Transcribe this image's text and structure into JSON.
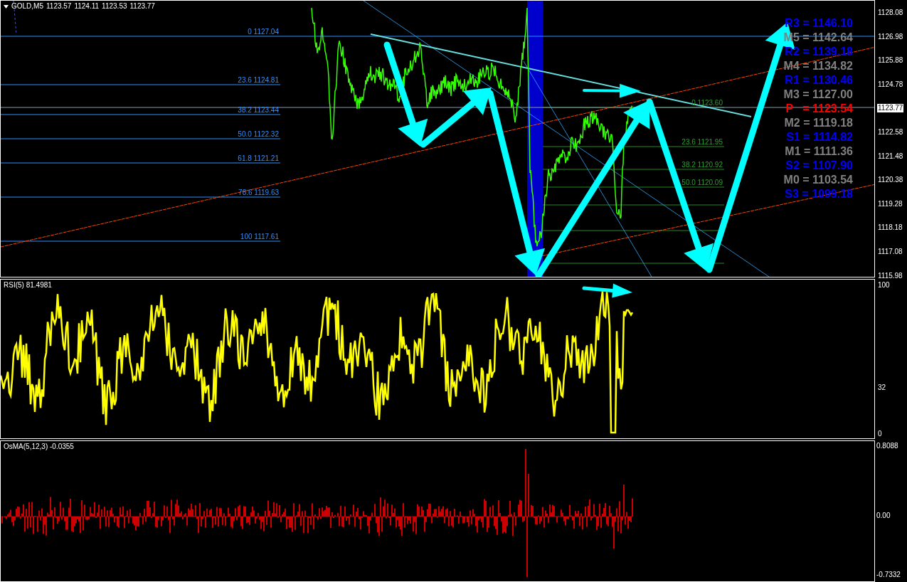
{
  "header": {
    "symbol": "GOLD,M5",
    "ohlc": [
      "1123.57",
      "1124.11",
      "1123.53",
      "1123.77"
    ]
  },
  "fib_left": [
    "0 1127.04",
    "23.6 1124.81",
    "38.2 1123.44",
    "50.0 1122.32",
    "61.8 1121.21",
    "78.6 1119.63",
    "100 1117.61"
  ],
  "fib_right": [
    "0 1123.60",
    "23.6 1121.95",
    "38.2 1120.92",
    "50.0 1120.09"
  ],
  "pivots": [
    {
      "label": "R3 = 1146.10",
      "color": "#0000ff"
    },
    {
      "label": "M5 = 1142.64",
      "color": "#808080"
    },
    {
      "label": "R2 = 1139.18",
      "color": "#0000ff"
    },
    {
      "label": "M4 = 1134.82",
      "color": "#808080"
    },
    {
      "label": "R1 = 1130.46",
      "color": "#0000ff"
    },
    {
      "label": "M3 = 1127.00",
      "color": "#808080"
    },
    {
      "label": "P   = 1123.54",
      "color": "#ff0000"
    },
    {
      "label": "M2 = 1119.18",
      "color": "#808080"
    },
    {
      "label": "S1 = 1114.82",
      "color": "#0000ff"
    },
    {
      "label": "M1 = 1111.36",
      "color": "#808080"
    },
    {
      "label": "S2 = 1107.90",
      "color": "#0000ff"
    },
    {
      "label": "M0 = 1103.54",
      "color": "#808080"
    },
    {
      "label": "S3 = 1099.18",
      "color": "#0000ff"
    }
  ],
  "price_axis": [
    {
      "label": "1128.08",
      "current": false
    },
    {
      "label": "1126.98",
      "current": false
    },
    {
      "label": "1125.88",
      "current": false
    },
    {
      "label": "1124.78",
      "current": false
    },
    {
      "label": "1123.77",
      "current": true
    },
    {
      "label": "1122.58",
      "current": false
    },
    {
      "label": "1121.48",
      "current": false
    },
    {
      "label": "1120.38",
      "current": false
    },
    {
      "label": "1119.28",
      "current": false
    },
    {
      "label": "1118.18",
      "current": false
    },
    {
      "label": "1117.08",
      "current": false
    },
    {
      "label": "1115.98",
      "current": false
    }
  ],
  "rsi": {
    "title": "RSI(5) 81.4981",
    "axis": [
      "100",
      "32",
      "0"
    ]
  },
  "osma": {
    "title": "OsMA(5,12,3) -0.0355",
    "axis": [
      "0.8088",
      "0.00",
      "-0.7332"
    ]
  }
}
